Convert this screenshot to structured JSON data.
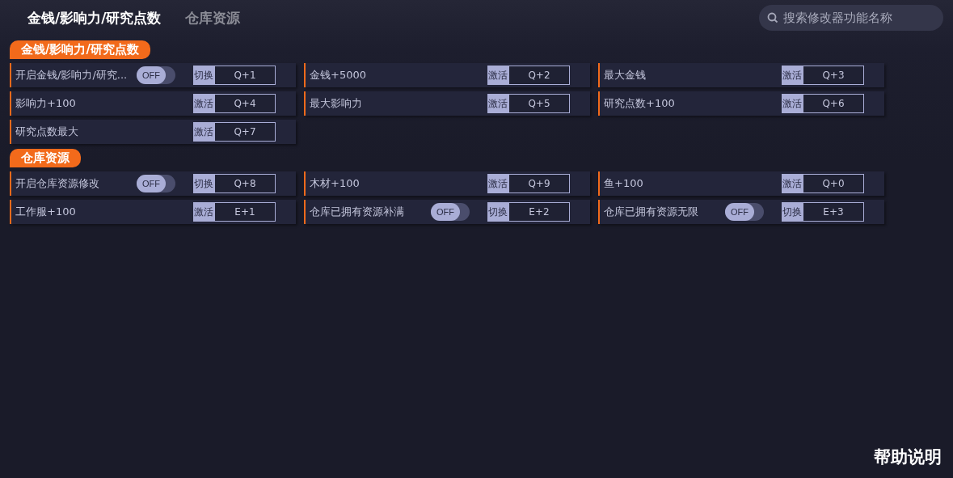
{
  "tabs": [
    {
      "label": "金钱/影响力/研究点数",
      "selected": true
    },
    {
      "label": "仓库资源",
      "selected": false
    }
  ],
  "search": {
    "placeholder": "搜索修改器功能名称"
  },
  "sections": [
    {
      "title": "金钱/影响力/研究点数",
      "items": [
        {
          "label": "开启金钱/影响力/研究...",
          "kind": "toggle",
          "on": false,
          "switch_text": "OFF",
          "action": "切换",
          "hotkey": "Q+1"
        },
        {
          "label": "金钱+5000",
          "kind": "button",
          "action": "激活",
          "hotkey": "Q+2"
        },
        {
          "label": "最大金钱",
          "kind": "button",
          "action": "激活",
          "hotkey": "Q+3"
        },
        {
          "label": "影响力+100",
          "kind": "button",
          "action": "激活",
          "hotkey": "Q+4"
        },
        {
          "label": "最大影响力",
          "kind": "button",
          "action": "激活",
          "hotkey": "Q+5"
        },
        {
          "label": "研究点数+100",
          "kind": "button",
          "action": "激活",
          "hotkey": "Q+6"
        },
        {
          "label": "研究点数最大",
          "kind": "button",
          "action": "激活",
          "hotkey": "Q+7"
        }
      ]
    },
    {
      "title": "仓库资源",
      "items": [
        {
          "label": "开启仓库资源修改",
          "kind": "toggle",
          "on": false,
          "switch_text": "OFF",
          "action": "切换",
          "hotkey": "Q+8"
        },
        {
          "label": "木材+100",
          "kind": "button",
          "action": "激活",
          "hotkey": "Q+9"
        },
        {
          "label": "鱼+100",
          "kind": "button",
          "action": "激活",
          "hotkey": "Q+0"
        },
        {
          "label": "工作服+100",
          "kind": "button",
          "action": "激活",
          "hotkey": "E+1"
        },
        {
          "label": "仓库已拥有资源补满",
          "kind": "toggle",
          "on": false,
          "switch_text": "OFF",
          "action": "切换",
          "hotkey": "E+2"
        },
        {
          "label": "仓库已拥有资源无限",
          "kind": "toggle",
          "on": false,
          "switch_text": "OFF",
          "action": "切换",
          "hotkey": "E+3"
        }
      ]
    }
  ],
  "help": "帮助说明"
}
